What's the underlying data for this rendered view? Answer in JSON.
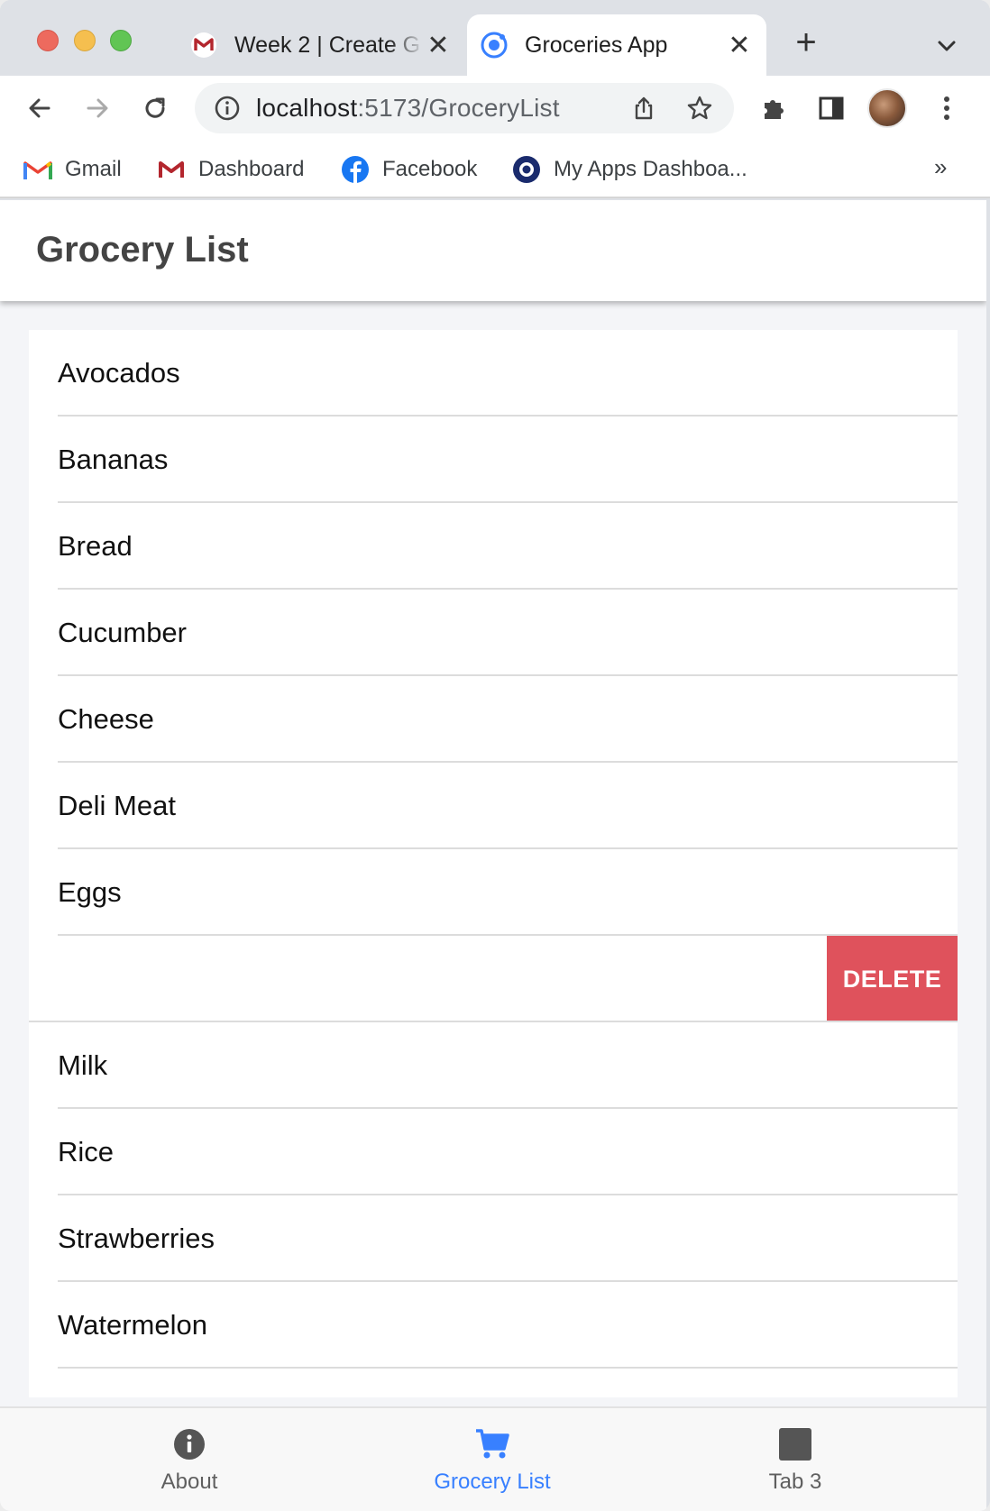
{
  "browser": {
    "tabs": [
      {
        "title": "Week 2 | Create G",
        "icon": "gmail-m-icon",
        "active": false
      },
      {
        "title": "Groceries App",
        "icon": "ionic-icon",
        "active": true
      }
    ],
    "url": {
      "host": "localhost",
      "path": ":5173/GroceryList"
    },
    "bookmarks": [
      {
        "label": "Gmail",
        "icon": "gmail-icon"
      },
      {
        "label": "Dashboard",
        "icon": "gmail-m-icon"
      },
      {
        "label": "Facebook",
        "icon": "facebook-icon"
      },
      {
        "label": "My Apps Dashboa...",
        "icon": "okta-icon"
      }
    ],
    "more_bookmarks": "»"
  },
  "app": {
    "header_title": "Grocery List",
    "items": [
      {
        "label": "Avocados"
      },
      {
        "label": "Bananas"
      },
      {
        "label": "Bread"
      },
      {
        "label": "Cucumber"
      },
      {
        "label": "Cheese"
      },
      {
        "label": "Deli Meat"
      },
      {
        "label": "Eggs"
      },
      {
        "label": "",
        "swiped": true,
        "action": "DELETE"
      },
      {
        "label": "Milk"
      },
      {
        "label": "Rice"
      },
      {
        "label": "Strawberries"
      },
      {
        "label": "Watermelon"
      }
    ],
    "tabbar": [
      {
        "label": "About",
        "icon": "info-icon",
        "selected": false
      },
      {
        "label": "Grocery List",
        "icon": "cart-icon",
        "selected": true
      },
      {
        "label": "Tab 3",
        "icon": "square-icon",
        "selected": false
      }
    ]
  },
  "colors": {
    "accent": "#3880ff",
    "danger": "#df525c",
    "header_text": "#444444"
  }
}
